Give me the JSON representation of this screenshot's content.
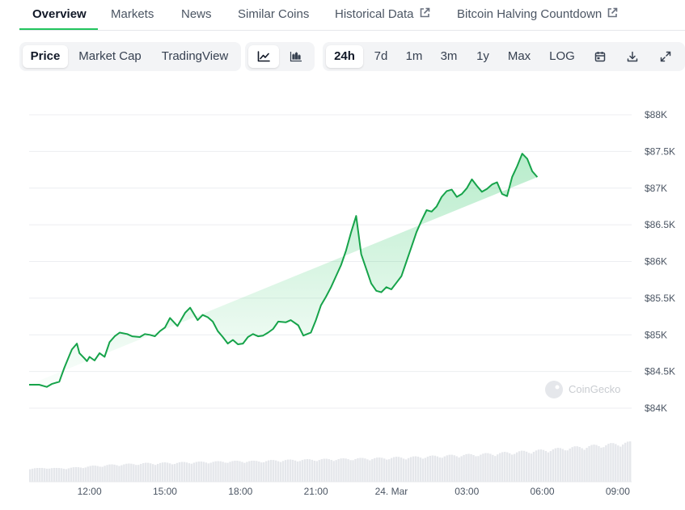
{
  "tabs": [
    {
      "label": "Overview",
      "active": true
    },
    {
      "label": "Markets"
    },
    {
      "label": "News"
    },
    {
      "label": "Similar Coins"
    },
    {
      "label": "Historical Data",
      "external": true
    },
    {
      "label": "Bitcoin Halving Countdown",
      "external": true
    }
  ],
  "controls": {
    "view_options": [
      "Price",
      "Market Cap",
      "TradingView"
    ],
    "selected_view": "Price",
    "chart_style_icons": [
      "line-chart-icon",
      "candlestick-chart-icon"
    ],
    "selected_style": "line-chart-icon",
    "ranges": [
      "24h",
      "7d",
      "1m",
      "3m",
      "1y",
      "Max",
      "LOG"
    ],
    "selected_range": "24h",
    "tool_icons": [
      "calendar-icon",
      "download-icon",
      "fullscreen-icon"
    ]
  },
  "watermark": "CoinGecko",
  "colors": {
    "line": "#16a34a",
    "area_top": "#22c55e",
    "volume": "#e5e7eb",
    "accent": "#22c55e"
  },
  "chart_data": {
    "type": "area",
    "title": "",
    "xlabel": "",
    "ylabel": "",
    "y_ticks": [
      "$84K",
      "$84.5K",
      "$85K",
      "$85.5K",
      "$86K",
      "$86.5K",
      "$87K",
      "$87.5K",
      "$88K"
    ],
    "ylim": [
      84000,
      88000
    ],
    "x_ticks": [
      "12:00",
      "15:00",
      "18:00",
      "21:00",
      "24. Mar",
      "03:00",
      "06:00",
      "09:00"
    ],
    "x_tick_hours": [
      12,
      15,
      18,
      21,
      24,
      27,
      30,
      33
    ],
    "xlim_hours": [
      9.6,
      33.55
    ],
    "grid": true,
    "series": [
      {
        "x_hours": [
          9.6,
          10.0,
          10.3,
          10.5,
          10.8,
          11.0,
          11.2,
          11.3,
          11.5,
          11.6,
          11.8,
          11.9,
          12.0,
          12.2,
          12.4,
          12.6,
          12.8,
          13.0,
          13.2,
          13.5,
          13.7,
          14.0,
          14.2,
          14.4,
          14.6,
          14.8,
          15.0,
          15.2,
          15.5,
          15.8,
          16.0,
          16.3,
          16.5,
          16.7,
          16.9,
          17.1,
          17.3,
          17.5,
          17.7,
          17.9,
          18.1,
          18.3,
          18.5,
          18.7,
          18.9,
          19.1,
          19.3,
          19.5,
          19.8,
          20.0,
          20.3,
          20.5,
          20.8,
          21.0,
          21.2,
          21.4,
          21.6,
          21.8,
          22.0,
          22.2,
          22.4,
          22.6,
          22.8,
          23.0,
          23.2,
          23.4,
          23.6,
          23.8,
          24.0,
          24.2,
          24.4,
          24.6,
          24.8,
          25.0,
          25.2,
          25.4,
          25.6,
          25.8,
          26.0,
          26.2,
          26.4,
          26.6,
          26.8,
          27.0,
          27.2,
          27.4,
          27.6,
          27.8,
          28.0,
          28.2,
          28.4,
          28.6,
          28.8,
          29.0,
          29.2,
          29.4,
          29.6,
          29.8,
          30.0,
          30.2,
          30.4,
          30.6,
          30.8,
          31.0,
          31.2,
          31.4,
          31.6,
          31.8,
          32.0,
          32.2,
          32.4,
          32.6,
          32.8,
          33.0,
          33.2,
          33.4,
          33.55
        ],
        "values": [
          84320,
          84320,
          84290,
          84330,
          84360,
          84550,
          84720,
          84800,
          84880,
          84750,
          84680,
          84640,
          84700,
          84650,
          84750,
          84700,
          84900,
          84980,
          85030,
          85010,
          84980,
          84970,
          85010,
          85000,
          84980,
          85050,
          85100,
          85230,
          85120,
          85300,
          85370,
          85200,
          85270,
          85240,
          85180,
          85050,
          84970,
          84880,
          84930,
          84870,
          84880,
          84970,
          85010,
          84980,
          84990,
          85030,
          85080,
          85180,
          85170,
          85200,
          85130,
          84990,
          85030,
          85200,
          85400,
          85520,
          85650,
          85800,
          85950,
          86150,
          86400,
          86620,
          86100,
          85900,
          85700,
          85600,
          85580,
          85650,
          85620,
          85710,
          85800,
          86000,
          86200,
          86400,
          86560,
          86700,
          86680,
          86750,
          86880,
          86960,
          86980,
          86880,
          86920,
          87000,
          87120,
          87030,
          86950,
          86990,
          87050,
          87080,
          86920,
          86890,
          87150,
          87300,
          87470,
          87400,
          87230,
          87150
        ]
      }
    ],
    "volume": {
      "relative_heights": [
        0.35,
        0.34,
        0.36,
        0.34,
        0.35,
        0.36,
        0.38,
        0.4,
        0.41,
        0.43,
        0.44,
        0.45,
        0.46,
        0.47,
        0.47,
        0.48,
        0.48,
        0.49,
        0.5,
        0.5,
        0.51,
        0.51,
        0.52,
        0.52,
        0.53,
        0.52,
        0.53,
        0.54,
        0.55,
        0.55,
        0.56,
        0.56,
        0.57,
        0.57,
        0.58,
        0.58,
        0.59,
        0.59,
        0.6,
        0.6,
        0.61,
        0.62,
        0.62,
        0.63,
        0.64,
        0.65,
        0.66,
        0.67,
        0.68,
        0.69,
        0.7,
        0.71,
        0.72,
        0.74,
        0.75,
        0.77,
        0.78,
        0.8,
        0.82,
        0.84,
        0.86,
        0.88,
        0.9,
        0.92,
        0.94,
        0.96,
        0.98,
        1.0
      ]
    }
  }
}
